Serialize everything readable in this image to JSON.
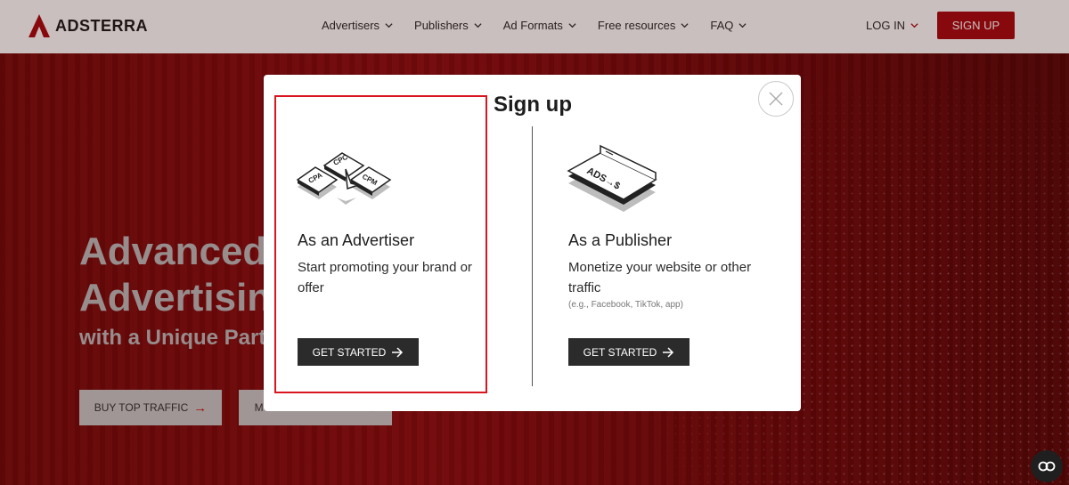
{
  "header": {
    "brand": "ADSTERRA",
    "nav": [
      "Advertisers",
      "Publishers",
      "Ad Formats",
      "Free resources",
      "FAQ"
    ],
    "login": "LOG IN",
    "signup": "SIGN UP"
  },
  "hero": {
    "line1": "Advanced",
    "line2": "Advertising",
    "line3": "with a Unique Partner",
    "button1": "BUY TOP TRAFFIC",
    "button2": "MONETIZE TRAFFIC"
  },
  "modal": {
    "title": "Sign up",
    "advertiser": {
      "icon_name": "cpa-cpc-cpm-icon",
      "title": "As an Advertiser",
      "desc": "Start promoting your brand or offer",
      "cta": "GET STARTED"
    },
    "publisher": {
      "icon_name": "ads-to-money-icon",
      "title": "As a Publisher",
      "desc": "Monetize your website or other traffic",
      "note": "(e.g., Facebook, TikTok, app)",
      "cta": "GET STARTED"
    }
  },
  "colors": {
    "brand_red": "#a90d12",
    "highlight_red": "#d9151d",
    "dark_button": "#2b2b2b"
  }
}
